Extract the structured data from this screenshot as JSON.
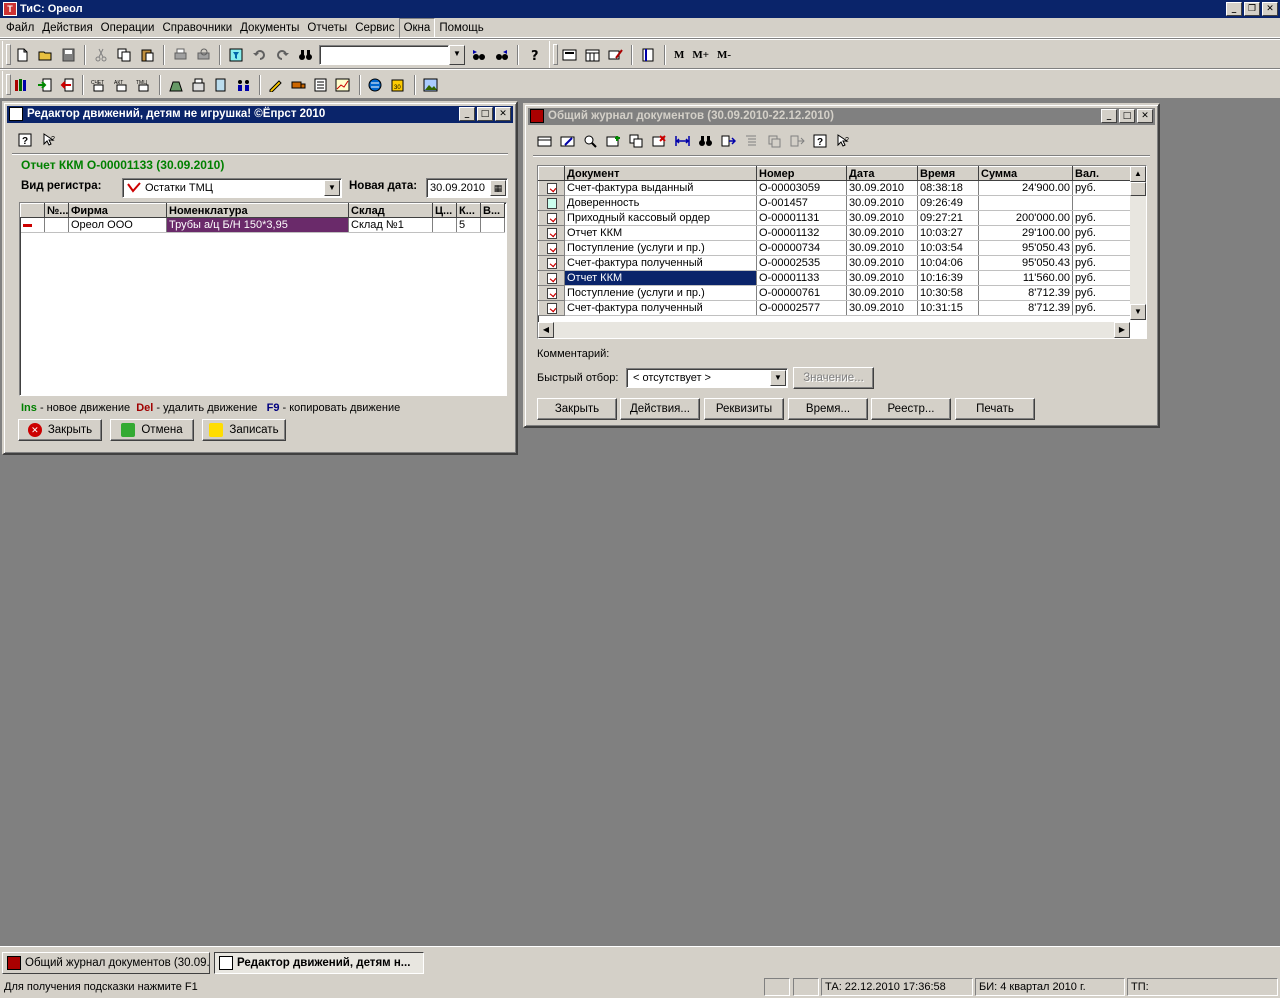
{
  "app": {
    "title": "ТиС: Ореол"
  },
  "menu": [
    "Файл",
    "Действия",
    "Операции",
    "Справочники",
    "Документы",
    "Отчеты",
    "Сервис",
    "Окна",
    "Помощь"
  ],
  "toolbar": {
    "m": "M",
    "m_plus": "M+",
    "m_minus": "M-",
    "search_value": ""
  },
  "editor": {
    "title": "Редактор движений, детям не игрушка! ©Ёпрст 2010",
    "doc_heading": "Отчет ККМ О-00001133 (30.09.2010)",
    "register_label": "Вид регистра:",
    "register_value": "Остатки ТМЦ",
    "date_label": "Новая дата:",
    "date_value": "30.09.2010",
    "columns": [
      "№...",
      "Фирма",
      "Номенклатура",
      "Склад",
      "Ц...",
      "К...",
      "В..."
    ],
    "rows": [
      {
        "num": "",
        "firm": "Ореол ООО",
        "item": "Трубы а/ц Б/Н 150*3,95",
        "store": "Склад №1",
        "c": "",
        "k": "5",
        "v": ""
      }
    ],
    "hint": {
      "ins_key": "Ins",
      "ins_text": " - новое движение",
      "del_key": "Del",
      "del_text": " - удалить движение",
      "f9_key": "F9",
      "f9_text": " - копировать движение"
    },
    "buttons": {
      "close": "Закрыть",
      "cancel": "Отмена",
      "save": "Записать"
    }
  },
  "journal": {
    "title": "Общий журнал документов (30.09.2010-22.12.2010)",
    "columns": [
      "Документ",
      "Номер",
      "Дата",
      "Время",
      "Сумма",
      "Вал."
    ],
    "rows": [
      {
        "doc": "Счет-фактура выданный",
        "num": "О-00003059",
        "date": "30.09.2010",
        "time": "08:38:18",
        "sum": "24'900.00",
        "cur": "руб.",
        "icon": "posted"
      },
      {
        "doc": "Доверенность",
        "num": "О-001457",
        "date": "30.09.2010",
        "time": "09:26:49",
        "sum": "",
        "cur": "",
        "icon": "plain"
      },
      {
        "doc": "Приходный кассовый ордер",
        "num": "О-00001131",
        "date": "30.09.2010",
        "time": "09:27:21",
        "sum": "200'000.00",
        "cur": "руб.",
        "icon": "posted"
      },
      {
        "doc": "Отчет ККМ",
        "num": "О-00001132",
        "date": "30.09.2010",
        "time": "10:03:27",
        "sum": "29'100.00",
        "cur": "руб.",
        "icon": "posted"
      },
      {
        "doc": "Поступление (услуги и пр.)",
        "num": "О-00000734",
        "date": "30.09.2010",
        "time": "10:03:54",
        "sum": "95'050.43",
        "cur": "руб.",
        "icon": "posted"
      },
      {
        "doc": "Счет-фактура полученный",
        "num": "О-00002535",
        "date": "30.09.2010",
        "time": "10:04:06",
        "sum": "95'050.43",
        "cur": "руб.",
        "icon": "posted"
      },
      {
        "doc": "Отчет ККМ",
        "num": "О-00001133",
        "date": "30.09.2010",
        "time": "10:16:39",
        "sum": "11'560.00",
        "cur": "руб.",
        "icon": "posted",
        "selected": true
      },
      {
        "doc": "Поступление (услуги и пр.)",
        "num": "О-00000761",
        "date": "30.09.2010",
        "time": "10:30:58",
        "sum": "8'712.39",
        "cur": "руб.",
        "icon": "posted"
      },
      {
        "doc": "Счет-фактура полученный",
        "num": "О-00002577",
        "date": "30.09.2010",
        "time": "10:31:15",
        "sum": "8'712.39",
        "cur": "руб.",
        "icon": "posted"
      }
    ],
    "comment_label": "Комментарий:",
    "filter_label": "Быстрый отбор:",
    "filter_value": "< отсутствует >",
    "value_button": "Значение...",
    "buttons": {
      "close": "Закрыть",
      "actions": "Действия...",
      "requisites": "Реквизиты",
      "time": "Время...",
      "registry": "Реестр...",
      "print": "Печать"
    }
  },
  "taskbar": [
    {
      "label": "Общий журнал документов (30.09....",
      "active": false
    },
    {
      "label": "Редактор движений, детям н...",
      "active": true
    }
  ],
  "status": {
    "hint": "Для получения подсказки нажмите F1",
    "ta": "ТА: 22.12.2010  17:36:58",
    "bi": "БИ: 4 квартал 2010 г.",
    "tp": "ТП:"
  }
}
